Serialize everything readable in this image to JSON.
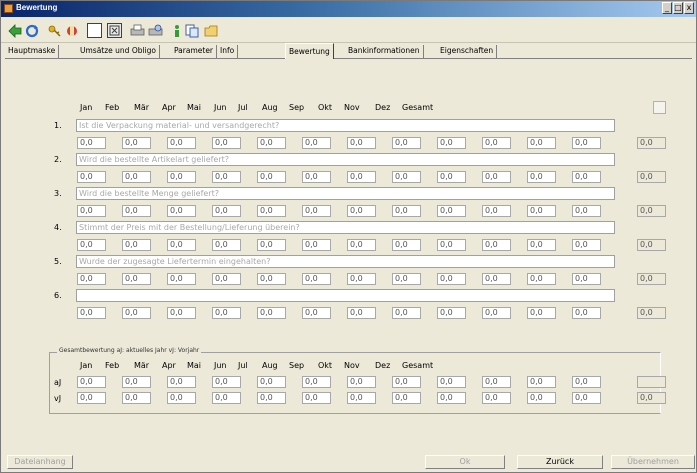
{
  "window": {
    "title": "Bewertung",
    "controls": [
      "_",
      "□",
      "x"
    ]
  },
  "toolbar": {
    "icons": [
      "back-arrow-icon",
      "refresh-icon",
      "key-icon",
      "tools-icon",
      "new-document-icon",
      "window-icon",
      "printer-icon",
      "print-preview-icon",
      "info-icon",
      "copy-icon",
      "folder-icon"
    ]
  },
  "tabs": [
    {
      "label": "Hauptmaske",
      "active": false
    },
    {
      "label": "Umsätze und Obligo",
      "active": false
    },
    {
      "label": "Parameter",
      "active": false
    },
    {
      "label": "Info",
      "active": false
    },
    {
      "label": "Bewertung",
      "active": true
    },
    {
      "label": "Bankinformationen",
      "active": false
    },
    {
      "label": "Eigenschaften",
      "active": false
    }
  ],
  "months": [
    "Jan",
    "Feb",
    "Mär",
    "Apr",
    "Mai",
    "Jun",
    "Jul",
    "Aug",
    "Sep",
    "Okt",
    "Nov",
    "Dez",
    "Gesamt"
  ],
  "questions": [
    {
      "num": "1.",
      "text": "Ist die Verpackung material- und versandgerecht?",
      "values": [
        "0,0",
        "0,0",
        "0,0",
        "0,0",
        "0,0",
        "0,0",
        "0,0",
        "0,0",
        "0,0",
        "0,0",
        "0,0",
        "0,0"
      ],
      "total": "0,0"
    },
    {
      "num": "2.",
      "text": "Wird die bestellte Artikelart geliefert?",
      "values": [
        "0,0",
        "0,0",
        "0,0",
        "0,0",
        "0,0",
        "0,0",
        "0,0",
        "0,0",
        "0,0",
        "0,0",
        "0,0",
        "0,0"
      ],
      "total": "0,0"
    },
    {
      "num": "3.",
      "text": "Wird die bestellte Menge geliefert?",
      "values": [
        "0,0",
        "0,0",
        "0,0",
        "0,0",
        "0,0",
        "0,0",
        "0,0",
        "0,0",
        "0,0",
        "0,0",
        "0,0",
        "0,0"
      ],
      "total": "0,0"
    },
    {
      "num": "4.",
      "text": "Stimmt der Preis mit der Bestellung/Lieferung überein?",
      "values": [
        "0,0",
        "0,0",
        "0,0",
        "0,0",
        "0,0",
        "0,0",
        "0,0",
        "0,0",
        "0,0",
        "0,0",
        "0,0",
        "0,0"
      ],
      "total": "0,0"
    },
    {
      "num": "5.",
      "text": "Wurde der zugesagte Liefertermin eingehalten?",
      "values": [
        "0,0",
        "0,0",
        "0,0",
        "0,0",
        "0,0",
        "0,0",
        "0,0",
        "0,0",
        "0,0",
        "0,0",
        "0,0",
        "0,0"
      ],
      "total": "0,0"
    },
    {
      "num": "6.",
      "text": "",
      "values": [
        "0,0",
        "0,0",
        "0,0",
        "0,0",
        "0,0",
        "0,0",
        "0,0",
        "0,0",
        "0,0",
        "0,0",
        "0,0",
        "0,0"
      ],
      "total": "0,0"
    }
  ],
  "summary": {
    "title": "Gesamtbewertung  aJ: aktuelles Jahr  vJ: Vorjahr",
    "rows": [
      {
        "label": "aJ",
        "values": [
          "0,0",
          "0,0",
          "0,0",
          "0,0",
          "0,0",
          "0,0",
          "0,0",
          "0,0",
          "0,0",
          "0,0",
          "0,0",
          "0,0"
        ],
        "total": ""
      },
      {
        "label": "vJ",
        "values": [
          "0,0",
          "0,0",
          "0,0",
          "0,0",
          "0,0",
          "0,0",
          "0,0",
          "0,0",
          "0,0",
          "0,0",
          "0,0",
          "0,0"
        ],
        "total": "0,0"
      }
    ]
  },
  "buttons": {
    "attachment": "Dateianhang",
    "ok": "Ok",
    "back": "Zurück",
    "apply": "Übernehmen"
  }
}
